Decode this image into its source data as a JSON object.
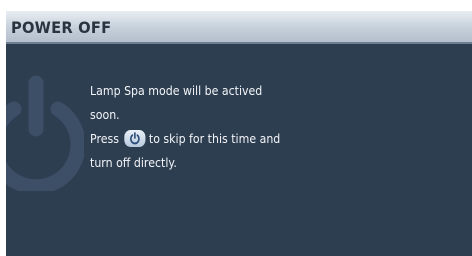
{
  "dialog": {
    "title": "POWER OFF",
    "message": {
      "line1": "Lamp Spa mode will be actived",
      "line2": "soon.",
      "line3_before": "Press",
      "line3_after": "to skip for this time and",
      "line4": "turn off directly."
    },
    "button_icon": "power-button-icon",
    "watermark_icon": "power-icon"
  },
  "colors": {
    "panel_background": "#2e3e51",
    "title_bar": "#c6d0da",
    "title_text": "#2a3340",
    "message_text": "#f2f4f7"
  }
}
